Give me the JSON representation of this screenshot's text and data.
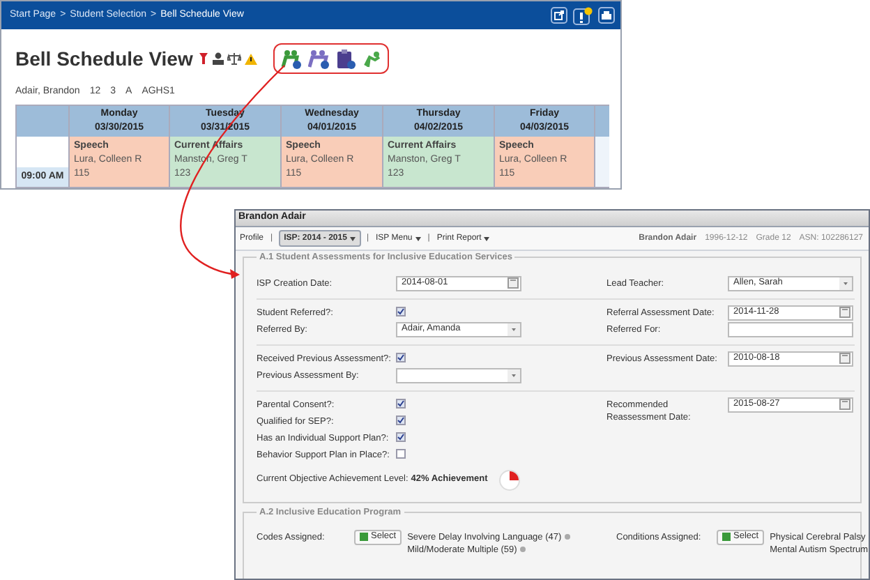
{
  "schedule_window": {
    "breadcrumb": [
      "Start Page",
      "Student Selection",
      "Bell Schedule View"
    ],
    "breadcrumb_separator": ">",
    "title": "Bell Schedule View",
    "student": [
      "Adair, Brandon",
      "12",
      "3",
      "A",
      "AGHS1"
    ],
    "days": [
      {
        "day": "Monday",
        "date": "03/30/2015"
      },
      {
        "day": "Tuesday",
        "date": "03/31/2015"
      },
      {
        "day": "Wednesday",
        "date": "04/01/2015"
      },
      {
        "day": "Thursday",
        "date": "04/02/2015"
      },
      {
        "day": "Friday",
        "date": "04/03/2015"
      }
    ],
    "time": "09:00 AM",
    "periods": [
      {
        "course": "Speech",
        "teacher": "Lura, Colleen R",
        "room": "115",
        "color": "#f9cdb8"
      },
      {
        "course": "Current Affairs",
        "teacher": "Manston, Greg T",
        "room": "123",
        "color": "#c8e6cf"
      },
      {
        "course": "Speech",
        "teacher": "Lura, Colleen R",
        "room": "115",
        "color": "#f9cdb8"
      },
      {
        "course": "Current Affairs",
        "teacher": "Manston, Greg T",
        "room": "123",
        "color": "#c8e6cf"
      },
      {
        "course": "Speech",
        "teacher": "Lura, Colleen R",
        "room": "115",
        "color": "#f9cdb8"
      }
    ]
  },
  "isp_window": {
    "title": "Brandon Adair",
    "menu_separator": "|",
    "menu": [
      {
        "label": "Profile",
        "dropdown": false,
        "selected": false
      },
      {
        "label": "ISP: 2014 - 2015",
        "dropdown": true,
        "selected": true
      },
      {
        "label": "ISP Menu",
        "dropdown": true,
        "selected": false
      },
      {
        "label": "Print Report",
        "dropdown": true,
        "selected": false
      }
    ],
    "student_info": [
      "Brandon Adair",
      "1996-12-12",
      "Grade 12",
      "ASN: 102286127"
    ],
    "section_a1": {
      "title": "A.1 Student Assessments for Inclusive Education Services",
      "groups": [
        {
          "left": [
            {
              "kind": "date",
              "label": "ISP Creation Date:",
              "value": "2014-08-01"
            }
          ],
          "right": [
            {
              "kind": "select",
              "label": "Lead Teacher:",
              "value": "Allen, Sarah"
            }
          ]
        },
        {
          "left": [
            {
              "kind": "checkbox",
              "label": "Student Referred?:",
              "checked": true
            },
            {
              "kind": "select",
              "label": "Referred By:",
              "value": "Adair, Amanda"
            }
          ],
          "right": [
            {
              "kind": "date",
              "label": "Referral Assessment Date:",
              "value": "2014-11-28"
            },
            {
              "kind": "text",
              "label": "Referred For:"
            }
          ]
        },
        {
          "left": [
            {
              "kind": "checkbox",
              "label": "Received Previous Assessment?:",
              "checked": true
            },
            {
              "kind": "select",
              "label": "Previous Assessment By:"
            }
          ],
          "right": [
            {
              "kind": "date",
              "label": "Previous Assessment Date:",
              "value": "2010-08-18"
            }
          ]
        },
        {
          "left": [
            {
              "kind": "checkbox",
              "label": "Parental Consent?:",
              "checked": true
            },
            {
              "kind": "checkbox",
              "label": "Qualified for SEP?:",
              "checked": true
            },
            {
              "kind": "checkbox",
              "label": "Has an Individual Support Plan?:",
              "checked": true
            },
            {
              "kind": "checkbox",
              "label": "Behavior Support Plan in Place?:",
              "checked": false
            },
            {
              "kind": "achievement",
              "label": "Current Objective Achievement Level:",
              "value": "42% Achievement"
            }
          ],
          "right": [
            {
              "kind": "date",
              "label": "Recommended Reassessment Date:",
              "value": "2015-08-27"
            }
          ]
        }
      ]
    },
    "section_a2": {
      "title": "A.2 Inclusive Education Program",
      "assignments": [
        {
          "label": "Codes Assigned:",
          "button": "Select",
          "items": [
            "Severe Delay Involving Language (47)",
            "Mild/Moderate Multiple (59)"
          ]
        },
        {
          "label": "Conditions Assigned:",
          "button": "Select",
          "items": [
            "Physical Cerebral Palsy",
            "Mental Autism Spectrum"
          ]
        }
      ]
    }
  }
}
